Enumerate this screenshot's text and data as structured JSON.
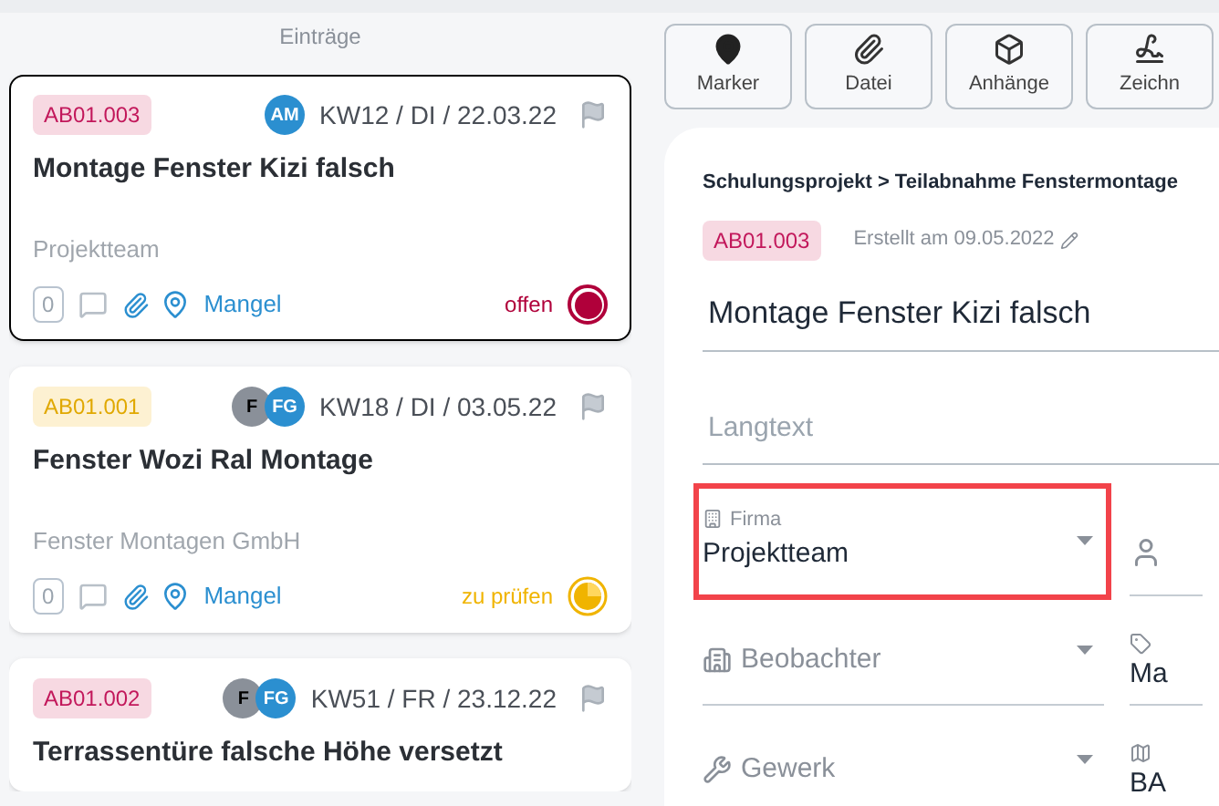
{
  "list_header": "Einträge",
  "entries": [
    {
      "tag": {
        "text": "AB01.003",
        "kind": "danger"
      },
      "avatars": [
        {
          "initials": "AM",
          "color": "#2b8fd0"
        }
      ],
      "date": "KW12 / DI / 22.03.22",
      "title": "Montage Fenster Kizi falsch",
      "company": "Projektteam",
      "count": "0",
      "category": "Mangel",
      "status": {
        "label": "offen",
        "kind": "open",
        "color": "#b0003a"
      },
      "selected": true
    },
    {
      "tag": {
        "text": "AB01.001",
        "kind": "warning"
      },
      "avatars": [
        {
          "initials": "F",
          "color": "#8a9099"
        },
        {
          "initials": "FG",
          "color": "#2b8fd0"
        }
      ],
      "date": "KW18 / DI / 03.05.22",
      "title": "Fenster Wozi Ral Montage",
      "company": "Fenster Montagen GmbH",
      "count": "0",
      "category": "Mangel",
      "status": {
        "label": "zu prüfen",
        "kind": "review",
        "color": "#f0b400"
      },
      "selected": false
    },
    {
      "tag": {
        "text": "AB01.002",
        "kind": "danger"
      },
      "avatars": [
        {
          "initials": "F",
          "color": "#8a9099"
        },
        {
          "initials": "FG",
          "color": "#2b8fd0"
        }
      ],
      "date": "KW51 / FR / 23.12.22",
      "title": "Terrassentüre falsche Höhe versetzt",
      "selected": false
    }
  ],
  "toolbar": [
    {
      "label": "Marker",
      "kind": "marker"
    },
    {
      "label": "Datei",
      "kind": "file"
    },
    {
      "label": "Anhänge",
      "kind": "attachments"
    },
    {
      "label": "Zeichn",
      "kind": "drawing"
    }
  ],
  "detail": {
    "breadcrumb": "Schulungsprojekt > Teilabnahme Fenstermontage",
    "tag": {
      "text": "AB01.003",
      "kind": "danger"
    },
    "created": "Erstellt am 09.05.2022",
    "title": "Montage Fenster Kizi falsch",
    "longtext": {
      "placeholder": "Langtext"
    },
    "fields": [
      {
        "kind": "company",
        "label": "Firma",
        "value": "Projektteam",
        "highlighted": true
      },
      {
        "kind": "observer",
        "placeholder": "Beobachter",
        "highlighted": false
      },
      {
        "kind": "trade",
        "placeholder": "Gewerk",
        "highlighted": false
      }
    ],
    "side_fields": [
      {
        "kind": "person"
      },
      {
        "kind": "tag",
        "value": "Ma"
      },
      {
        "kind": "map",
        "value": "BA"
      }
    ]
  }
}
